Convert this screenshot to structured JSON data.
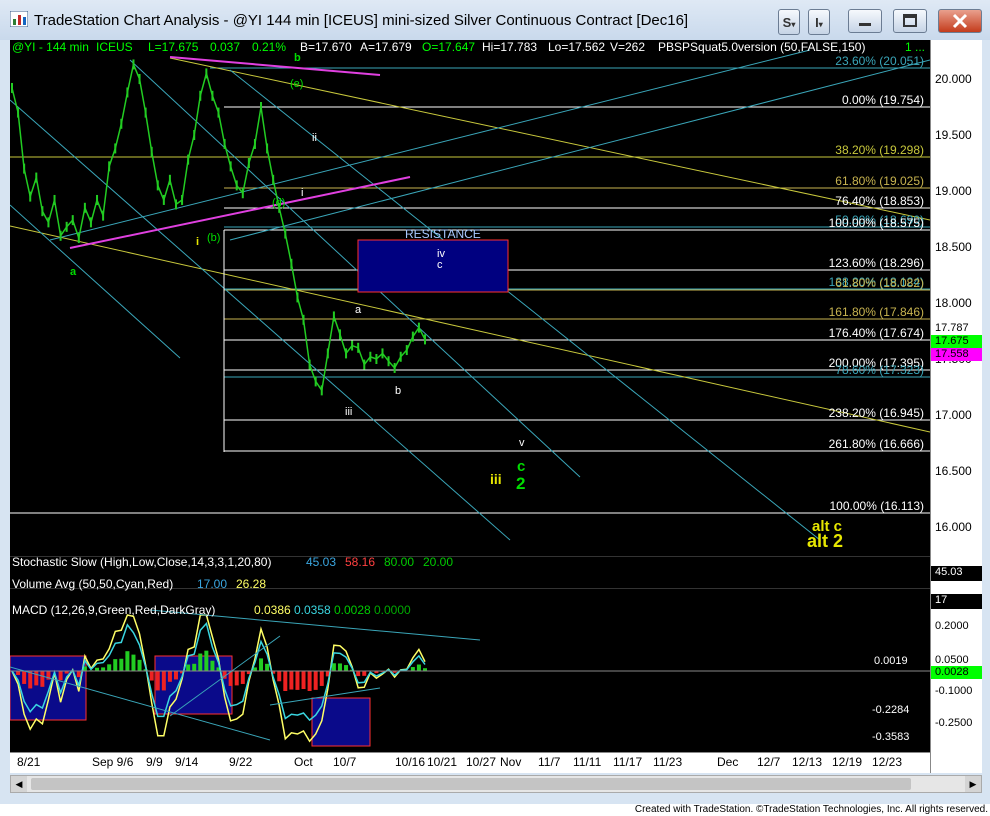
{
  "window": {
    "title": "TradeStation Chart Analysis - @YI 144 min [ICEUS] mini-sized Silver Continuous Contract [Dec16]",
    "buttons": {
      "s_label": "S",
      "i_label": "I"
    }
  },
  "header": {
    "symbol": "@YI - 144 min",
    "exchange": "ICEUS",
    "last": "L=17.675",
    "net_change": "0.037",
    "pct_change": "0.21%",
    "bid": "B=17.670",
    "ask": "A=17.679",
    "open": "O=17.647",
    "high": "Hi=17.783",
    "low": "Lo=17.562",
    "volume": "V=262",
    "study": "PBSPSquat5.0version (50,FALSE,150)",
    "study_value": "1 ..."
  },
  "fib_levels": [
    {
      "label": "23.60% (20.051)",
      "color": "#3aa6b9"
    },
    {
      "label": "0.00% (19.754)",
      "color": "#ffffff"
    },
    {
      "label": "38.20% (19.298)",
      "color": "#c8c83c"
    },
    {
      "label": "61.80% (19.025)",
      "color": "#c8b450"
    },
    {
      "label": "76.40% (18.853)",
      "color": "#ffffff"
    },
    {
      "label": "50.00% (18.690)",
      "color": "#3aa6b9"
    },
    {
      "label": "100.00% (18.575)",
      "color": "#ffffff"
    },
    {
      "label": "123.60% (18.296)",
      "color": "#ffffff"
    },
    {
      "label": "138.20% (18.124)",
      "color": "#3aa6b9"
    },
    {
      "label": "61.80% (18.082)",
      "color": "#c8b450"
    },
    {
      "label": "161.80% (17.846)",
      "color": "#c8b450"
    },
    {
      "label": "176.40% (17.674)",
      "color": "#ffffff"
    },
    {
      "label": "200.00% (17.395)",
      "color": "#ffffff"
    },
    {
      "label": "78.60% (17.323)",
      "color": "#3aa6b9"
    },
    {
      "label": "238.20% (16.945)",
      "color": "#ffffff"
    },
    {
      "label": "261.80% (16.666)",
      "color": "#ffffff"
    },
    {
      "label": "100.00% (16.113)",
      "color": "#ffffff"
    }
  ],
  "annotations": {
    "resistance": "RESISTANCE",
    "wave_iv": "iv",
    "wave_c_small": "c",
    "wave_b_green": "b",
    "wave_e": "(e)",
    "wave_ii": "ii",
    "wave_i_small": "i",
    "wave_d": "(d)",
    "wave_b_paren": "(b)",
    "wave_i_yellow": "i",
    "wave_a_green": "a",
    "wave_a_small": "a",
    "wave_b_small": "b",
    "wave_iii_small": "iii",
    "wave_v": "v",
    "wave_iii_yellow": "iii",
    "wave_c_green": "c",
    "wave_2_green": "2",
    "alt_c": "alt c",
    "alt_2": "alt 2"
  },
  "price_axis": {
    "ticks": [
      "20.000",
      "19.500",
      "19.000",
      "18.500",
      "18.000",
      "17.500",
      "17.000",
      "16.500",
      "16.000"
    ],
    "badges": [
      {
        "value": "17.787",
        "bg": "#ffffff",
        "fg": "#000000"
      },
      {
        "value": "17.675",
        "bg": "#00ff00",
        "fg": "#000000"
      },
      {
        "value": "17.558",
        "bg": "#ff00ff",
        "fg": "#000000"
      }
    ]
  },
  "stochastic": {
    "label": "Stochastic Slow (High,Low,Close,14,3,3,1,20,80)",
    "k": "45.03",
    "d": "58.16",
    "ob": "80.00",
    "os": "20.00",
    "axis_badge": "45.03"
  },
  "volume_avg": {
    "label": "Volume Avg (50,50,Cyan,Red)",
    "v1": "17.00",
    "v2": "26.28",
    "axis_badge": "17"
  },
  "macd": {
    "label": "MACD (12,26,9,Green,Red,DarkGray)",
    "macd": "0.0386",
    "signal": "0.0358",
    "diff": "0.0028",
    "zero": "0.0000",
    "ticks": [
      "0.2000",
      "0.0500",
      "-0.1000",
      "-0.2500"
    ],
    "badge": "0.0028",
    "inline_values": [
      "0.0019",
      "-0.2284",
      "-0.3583"
    ]
  },
  "date_axis": {
    "ticks": [
      "8/21",
      "Sep 9/6",
      "9/9",
      "9/14",
      "9/22",
      "Oct",
      "10/7",
      "10/16",
      "10/21",
      "10/27",
      "Nov",
      "11/7",
      "11/11",
      "11/17",
      "11/23",
      "Dec",
      "12/7",
      "12/13",
      "12/19",
      "12/23"
    ]
  },
  "footer": {
    "copyright": "Created with TradeStation. ©TradeStation Technologies, Inc. All rights reserved."
  },
  "price_series": [
    19.92,
    19.7,
    19.2,
    18.95,
    19.12,
    18.82,
    18.72,
    18.92,
    18.6,
    18.68,
    18.74,
    18.58,
    18.85,
    18.72,
    18.92,
    18.78,
    19.22,
    19.38,
    19.6,
    19.88,
    20.13,
    20.0,
    19.7,
    19.35,
    19.05,
    18.92,
    19.1,
    18.88,
    18.92,
    19.28,
    19.5,
    19.85,
    20.05,
    19.85,
    19.7,
    19.42,
    19.22,
    19.05,
    18.98,
    19.25,
    19.42,
    19.75,
    19.38,
    19.1,
    18.85,
    18.62,
    18.35,
    18.05,
    17.85,
    17.45,
    17.3,
    17.22,
    17.55,
    17.88,
    17.72,
    17.55,
    17.62,
    17.6,
    17.45,
    17.52,
    17.5,
    17.55,
    17.48,
    17.42,
    17.52,
    17.58,
    17.7,
    17.78,
    17.675
  ]
}
